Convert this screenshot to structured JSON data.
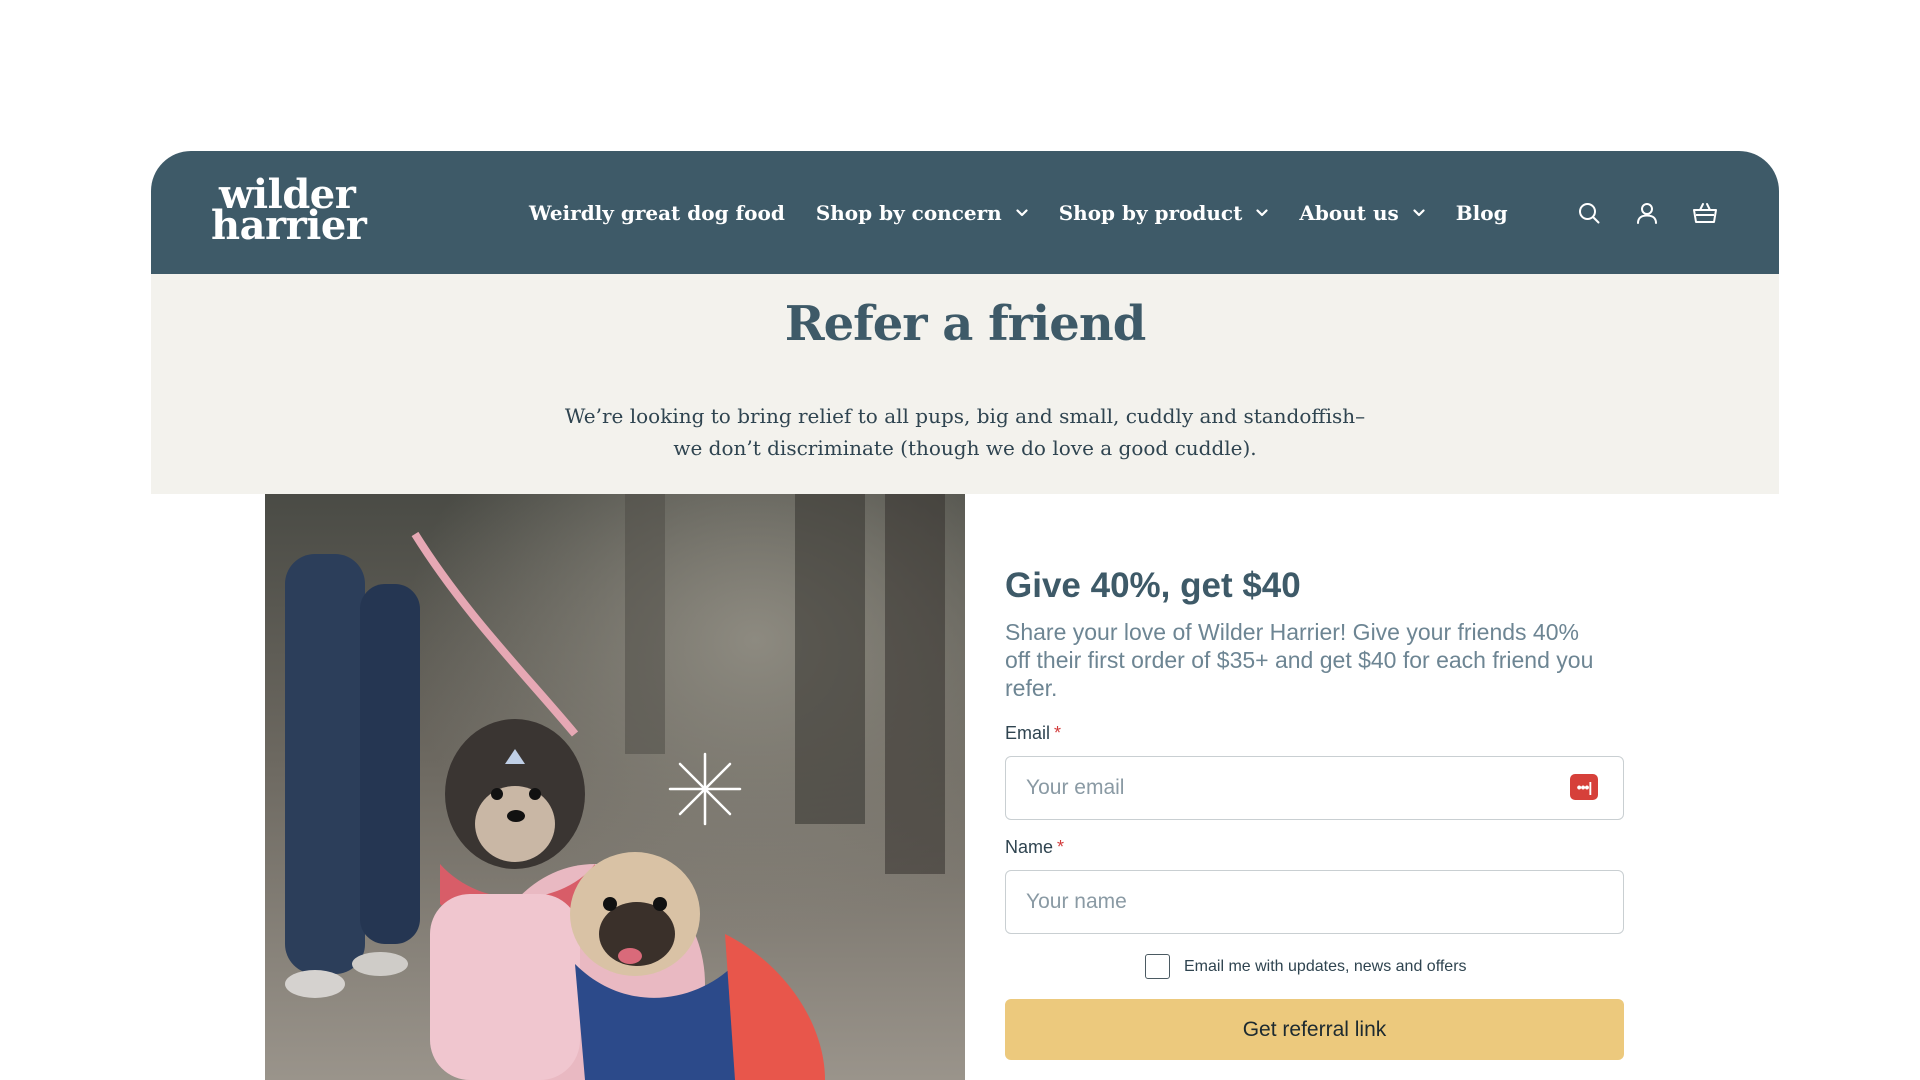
{
  "header": {
    "logo_line1": "wilder",
    "logo_line2": "harrier",
    "nav": [
      {
        "label": "Weirdly great dog food"
      },
      {
        "label": "Shop by concern"
      },
      {
        "label": "Shop by product"
      },
      {
        "label": "About us"
      },
      {
        "label": "Blog"
      }
    ],
    "icons": [
      "search-icon",
      "account-icon",
      "cart-icon"
    ]
  },
  "hero": {
    "title": "Refer a friend",
    "text": "We’re looking to bring relief to all pups, big and small, cuddly and standoffish– we don’t discriminate (though we do love a good cuddle)."
  },
  "referral": {
    "title": "Give 40%, get $40",
    "description": "Share your love of Wilder Harrier! Give your friends 40% off their first order of $35+ and get $40 for each friend you refer.",
    "email_label": "Email",
    "email_placeholder": "Your email",
    "name_label": "Name",
    "name_placeholder": "Your name",
    "required_mark": "*",
    "password_manager_badge": "•••|",
    "consent_label": "Email me with updates, news and offers",
    "consent_checked": false,
    "submit_label": "Get referral link"
  },
  "colors": {
    "header_bg": "#3e5a68",
    "hero_bg": "#f3f2ed",
    "button_bg": "#ecc97d",
    "required": "#d23b3b"
  }
}
